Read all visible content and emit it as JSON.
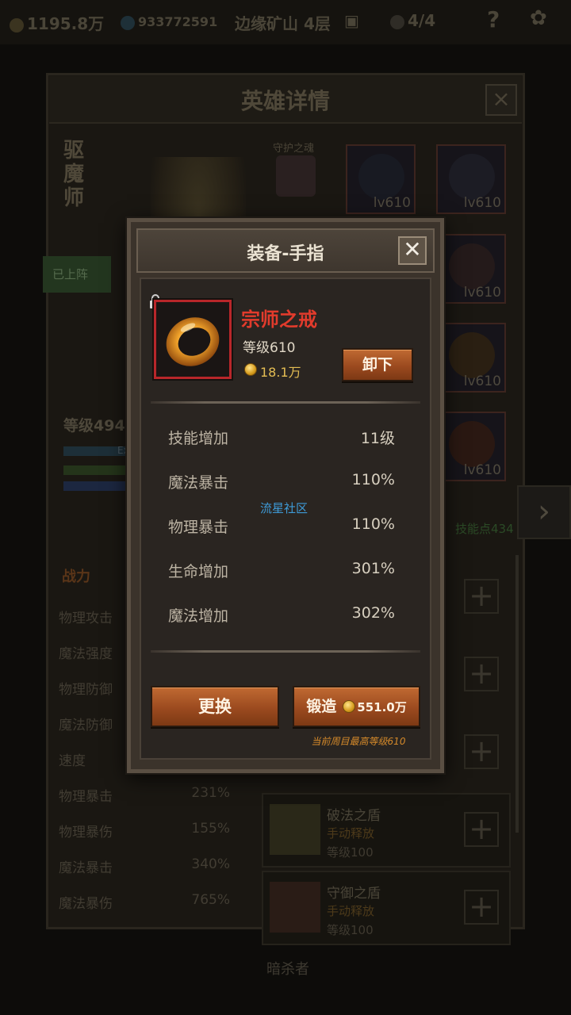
{
  "topbar": {
    "gold": "1195.8万",
    "gems": "933772591",
    "location": "边缘矿山 4层",
    "team": "4/4",
    "help": "?"
  },
  "hero_panel": {
    "title": "英雄详情",
    "hero_name": "驱魔师",
    "guardian_label": "守护之魂",
    "on_team_label": "已上阵",
    "level_label": "等级494",
    "exp_label": "Ex",
    "skill_points": "技能点434",
    "equipment_slots": [
      {
        "name": "hood",
        "level": "lv610"
      },
      {
        "name": "amulet",
        "level": "lv610"
      },
      {
        "name": "boots",
        "level": "lv610"
      },
      {
        "name": "ring",
        "level": "lv610"
      },
      {
        "name": "bracer",
        "level": "lv610"
      }
    ],
    "stats_tab": "战力",
    "stats": [
      {
        "label": "物理攻击",
        "value": ""
      },
      {
        "label": "魔法强度",
        "value": ""
      },
      {
        "label": "物理防御",
        "value": ""
      },
      {
        "label": "魔法防御",
        "value": ""
      },
      {
        "label": "速度",
        "value": ""
      },
      {
        "label": "物理暴击",
        "value": "231%"
      },
      {
        "label": "物理暴伤",
        "value": "155%"
      },
      {
        "label": "魔法暴击",
        "value": "340%"
      },
      {
        "label": "魔法暴伤",
        "value": "765%"
      }
    ],
    "skills": [
      {
        "name": "破法之盾",
        "type": "手动释放",
        "level": "等级100"
      },
      {
        "name": "守御之盾",
        "type": "手动释放",
        "level": "等级100"
      }
    ],
    "bottom_label": "暗杀者"
  },
  "dialog": {
    "title": "装备-手指",
    "close_label": "✕",
    "item": {
      "name": "宗师之戒",
      "level": "等级610",
      "price": "18.1万",
      "name_color": "#e23b2c"
    },
    "unequip_label": "卸下",
    "attributes": [
      {
        "label": "技能增加",
        "value": "11级"
      },
      {
        "label": "魔法暴击",
        "value": "110%"
      },
      {
        "label": "物理暴击",
        "value": "110%"
      },
      {
        "label": "生命增加",
        "value": "301%"
      },
      {
        "label": "魔法增加",
        "value": "302%"
      }
    ],
    "watermark": "流星社区",
    "replace_label": "更换",
    "forge_label": "锻造",
    "forge_cost": "551.0万",
    "max_level_note": "当前周目最高等级610"
  }
}
